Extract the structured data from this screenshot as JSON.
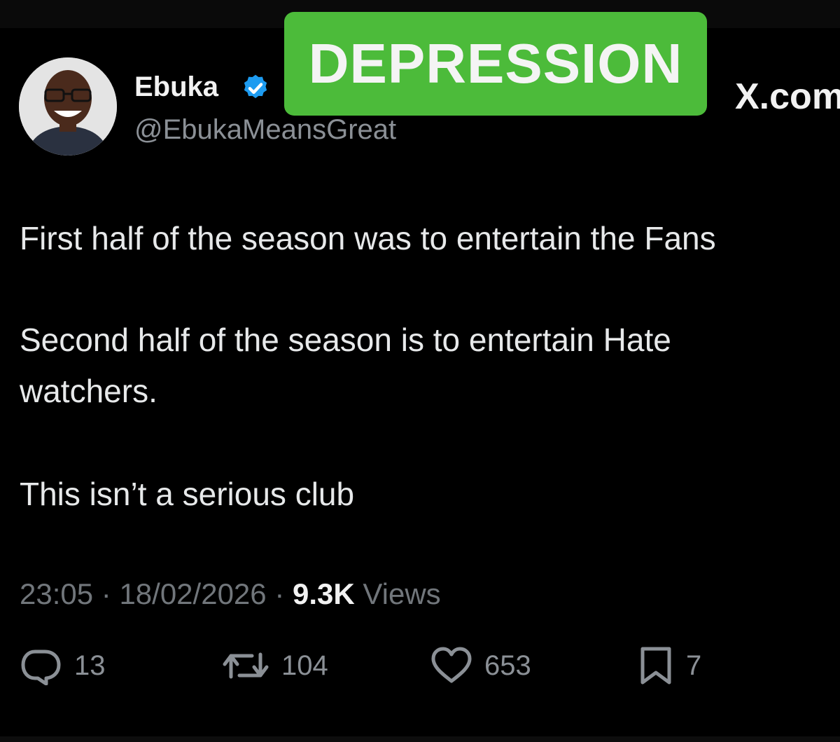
{
  "overlay": {
    "label": "DEPRESSION",
    "color": "#4cbb3a"
  },
  "watermark": {
    "text": "X.com"
  },
  "author": {
    "display_name": "Ebuka",
    "handle": "@EbukaMeansGreat",
    "verified": true,
    "verified_color": "#1d9bf0",
    "avatar": "avatar-photo"
  },
  "tweet": {
    "lines": [
      "First half of the season was to entertain the Fans",
      "Second half of the season is to entertain Hate",
      "watchers.",
      "This isn’t a serious club"
    ]
  },
  "meta": {
    "time": "23:05",
    "separator": " · ",
    "date": "18/02/2026",
    "views_count": "9.3K",
    "views_label": " Views"
  },
  "actions": {
    "replies": {
      "icon": "reply-icon",
      "count": "13"
    },
    "reposts": {
      "icon": "repost-icon",
      "count": "104"
    },
    "likes": {
      "icon": "heart-icon",
      "count": "653"
    },
    "bookmarks": {
      "icon": "bookmark-icon",
      "count": "7"
    }
  },
  "colors": {
    "background": "#000000",
    "text": "#e7e9ea",
    "secondary_text": "#71767b"
  }
}
